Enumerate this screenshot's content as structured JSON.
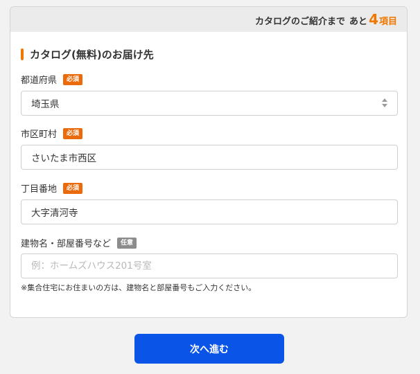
{
  "header": {
    "progress_prefix": "カタログのご紹介まで",
    "progress_middle": "あと",
    "remaining_count": "4",
    "progress_unit": "項目"
  },
  "section": {
    "title": "カタログ(無料)のお届け先"
  },
  "fields": {
    "prefecture": {
      "label": "都道府県",
      "badge": "必須",
      "value": "埼玉県"
    },
    "city": {
      "label": "市区町村",
      "badge": "必須",
      "value": "さいたま市西区"
    },
    "address": {
      "label": "丁目番地",
      "badge": "必須",
      "value": "大字清河寺"
    },
    "building": {
      "label": "建物名・部屋番号など",
      "badge": "任意",
      "placeholder": "例：ホームズハウス201号室"
    }
  },
  "note": "※集合住宅にお住まいの方は、建物名と部屋番号もご入力ください。",
  "next_button": "次へ進む",
  "colors": {
    "accent": "#f07800",
    "required_badge": "#ea6a0c",
    "optional_badge": "#8c8c8c",
    "primary_button": "#0a54e8"
  },
  "icons": {
    "select_arrow": "updown-arrows-icon"
  }
}
